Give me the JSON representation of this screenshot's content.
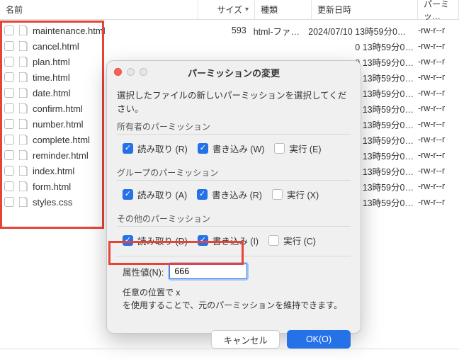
{
  "columns": {
    "name": "名前",
    "size": "サイズ",
    "type": "種類",
    "date": "更新日時",
    "perm": "パーミッ…"
  },
  "files": [
    "maintenance.html",
    "cancel.html",
    "plan.html",
    "time.html",
    "date.html",
    "confirm.html",
    "number.html",
    "complete.html",
    "reminder.html",
    "index.html",
    "form.html",
    "styles.css"
  ],
  "row_meta": {
    "size": "593",
    "type": "html-ファ…",
    "date_full": "2024/07/10 13時59分0…",
    "date_short": "0 13時59分0…",
    "perm": "-rw-r--r"
  },
  "dialog": {
    "title": "パーミッションの変更",
    "desc": "選択したファイルの新しいパーミッションを選択してください。",
    "owner_title": "所有者のパーミッション",
    "group_title": "グループのパーミッション",
    "other_title": "その他のパーミッション",
    "owner": {
      "read": "読み取り (R)",
      "write": "書き込み (W)",
      "exec": "実行 (E)"
    },
    "group": {
      "read": "読み取り (A)",
      "write": "書き込み (R)",
      "exec": "実行 (X)"
    },
    "other": {
      "read": "読み取り (D)",
      "write": "書き込み (I)",
      "exec": "実行 (C)"
    },
    "attr_label": "属性値(N):",
    "attr_value": "666",
    "hint_l1": "任意の位置で x",
    "hint_l2": "を使用することで、元のパーミッションを維持できます。",
    "cancel": "キャンセル",
    "ok": "OK(O)"
  }
}
